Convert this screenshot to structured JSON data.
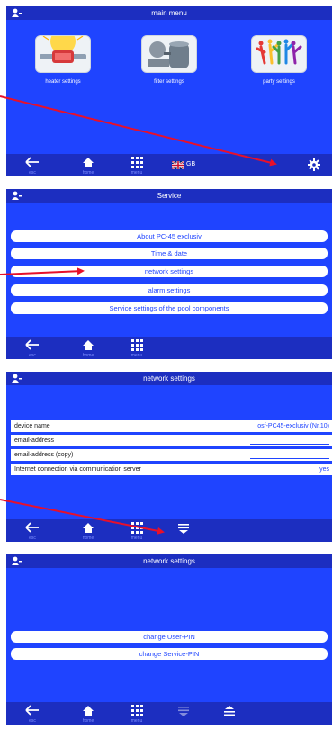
{
  "screen1": {
    "title": "main menu",
    "tiles": [
      {
        "label": "heater settings"
      },
      {
        "label": "filter settings"
      },
      {
        "label": "party settings"
      }
    ],
    "bottom": {
      "esc": "esc",
      "home": "home",
      "menu": "menu",
      "lang": "GB"
    }
  },
  "screen2": {
    "title": "Service",
    "items": [
      "About PC-45 exclusiv",
      "Time & date",
      "network settings",
      "alarm settings",
      "Service settings of the pool components"
    ],
    "bottom": {
      "esc": "esc",
      "home": "home",
      "menu": "menu"
    }
  },
  "screen3": {
    "title": "network settings",
    "rows": [
      {
        "label": "device name",
        "value": "osf-PC45-exclusiv (Nr.10)"
      },
      {
        "label": "email-address",
        "value": ""
      },
      {
        "label": "email-address (copy)",
        "value": ""
      },
      {
        "label": "Internet connection via communication server",
        "value": "yes"
      }
    ],
    "bottom": {
      "esc": "esc",
      "home": "home",
      "menu": "menu"
    }
  },
  "screen4": {
    "title": "network settings",
    "items": [
      "change User-PIN",
      "change Service-PIN"
    ],
    "bottom": {
      "esc": "esc",
      "home": "home",
      "menu": "menu"
    }
  },
  "colors": {
    "screen_bg": "#1f44ff",
    "bar_bg": "#1c2ec0",
    "arrow": "#e8102a"
  }
}
